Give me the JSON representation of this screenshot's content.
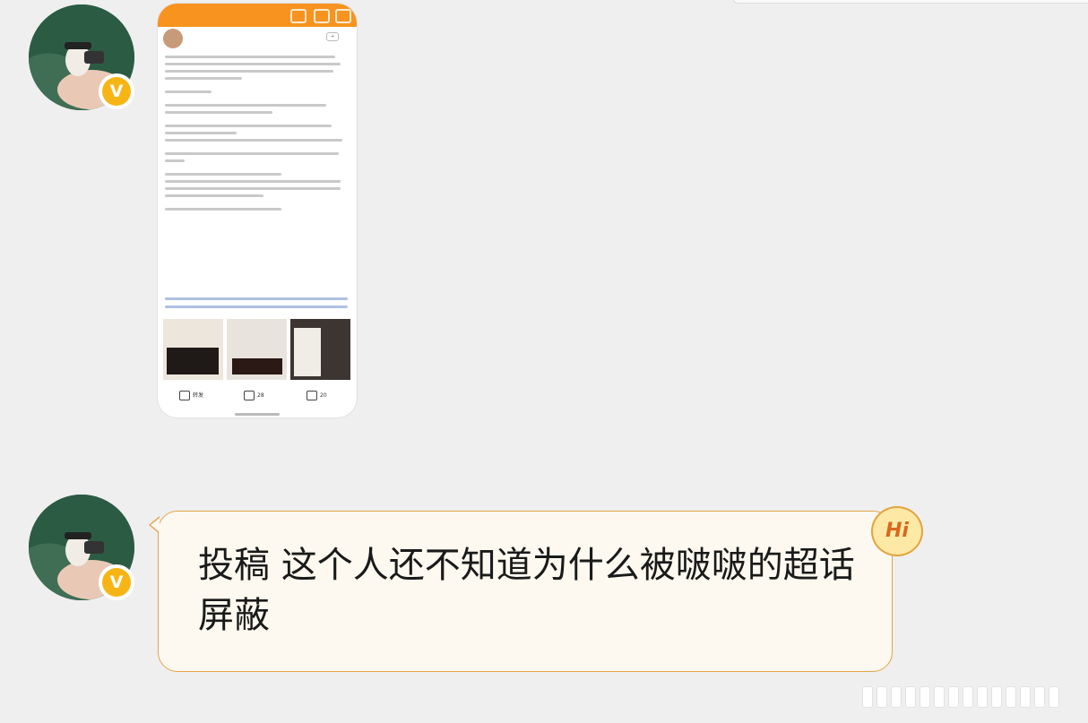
{
  "message": {
    "text": "投稿 这个人还不知道为什么被啵啵的超话屏蔽",
    "badge": "Hi"
  },
  "avatar_badge": "V",
  "post_card": {
    "actions": [
      {
        "label": "转发",
        "icon": "share-icon"
      },
      {
        "label": "28",
        "icon": "comment-icon"
      },
      {
        "label": "20",
        "icon": "like-icon"
      }
    ]
  },
  "colors": {
    "background": "#efefef",
    "bubble_bg": "#fdf9f0",
    "bubble_border": "#e4a44a",
    "badge_yellow": "#f7b515",
    "card_header_orange": "#f7931e"
  }
}
